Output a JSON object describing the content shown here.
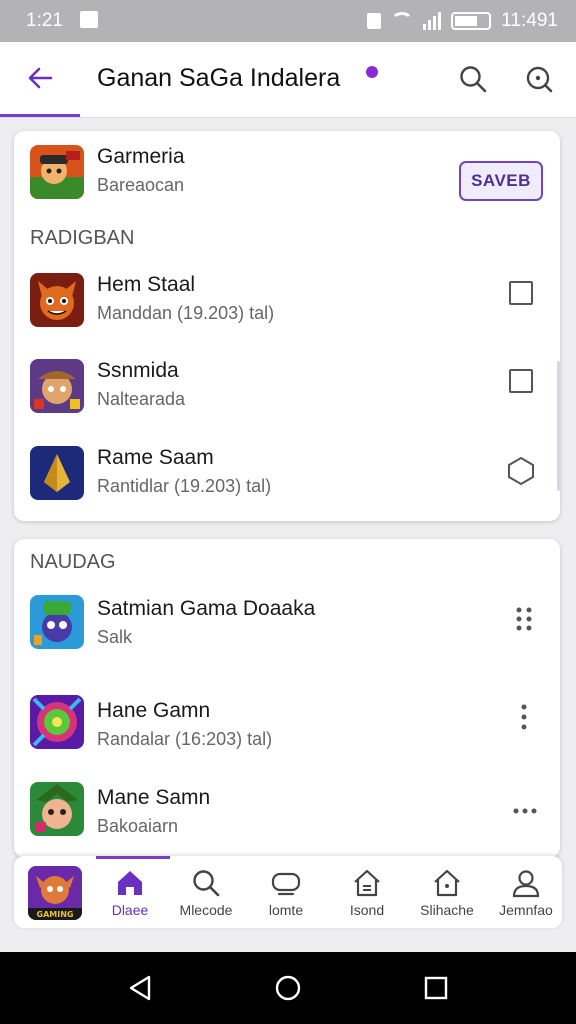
{
  "status_bar": {
    "time": "1:21",
    "right_text": "11:491"
  },
  "app_bar": {
    "title": "Ganan SaGa Indalera"
  },
  "card1": {
    "featured": {
      "title": "Garmeria",
      "subtitle": "Bareaocan",
      "button": "SAVEB"
    },
    "section": "RADIGBAN",
    "items": [
      {
        "title": "Hem Staal",
        "subtitle": "Manddan (19.203) tal)"
      },
      {
        "title": "Ssnmida",
        "subtitle": "Naltearada"
      },
      {
        "title": "Rame Saam",
        "subtitle": "Rantidlar (19.203) tal)"
      }
    ]
  },
  "card2": {
    "section": "NAUDAG",
    "items": [
      {
        "title": "Satmian Gama Doaaka",
        "subtitle": "Salk"
      },
      {
        "title": "Hane Gamn",
        "subtitle": "Randalar (16:203) tal)"
      },
      {
        "title": "Mane Samn",
        "subtitle": "Bakoaiarn"
      }
    ]
  },
  "bottom_nav": {
    "thumb_label": "GAMING",
    "items": [
      {
        "label": "Dlaee",
        "icon": "home-icon"
      },
      {
        "label": "Mlecode",
        "icon": "search-icon"
      },
      {
        "label": "lomte",
        "icon": "controller-icon"
      },
      {
        "label": "Isond",
        "icon": "house-icon"
      },
      {
        "label": "Slihache",
        "icon": "home-outline-icon"
      },
      {
        "label": "Jemnfao",
        "icon": "person-icon"
      }
    ]
  },
  "colors": {
    "accent": "#7a3ec8",
    "status_bar": "#b3b3b6"
  }
}
